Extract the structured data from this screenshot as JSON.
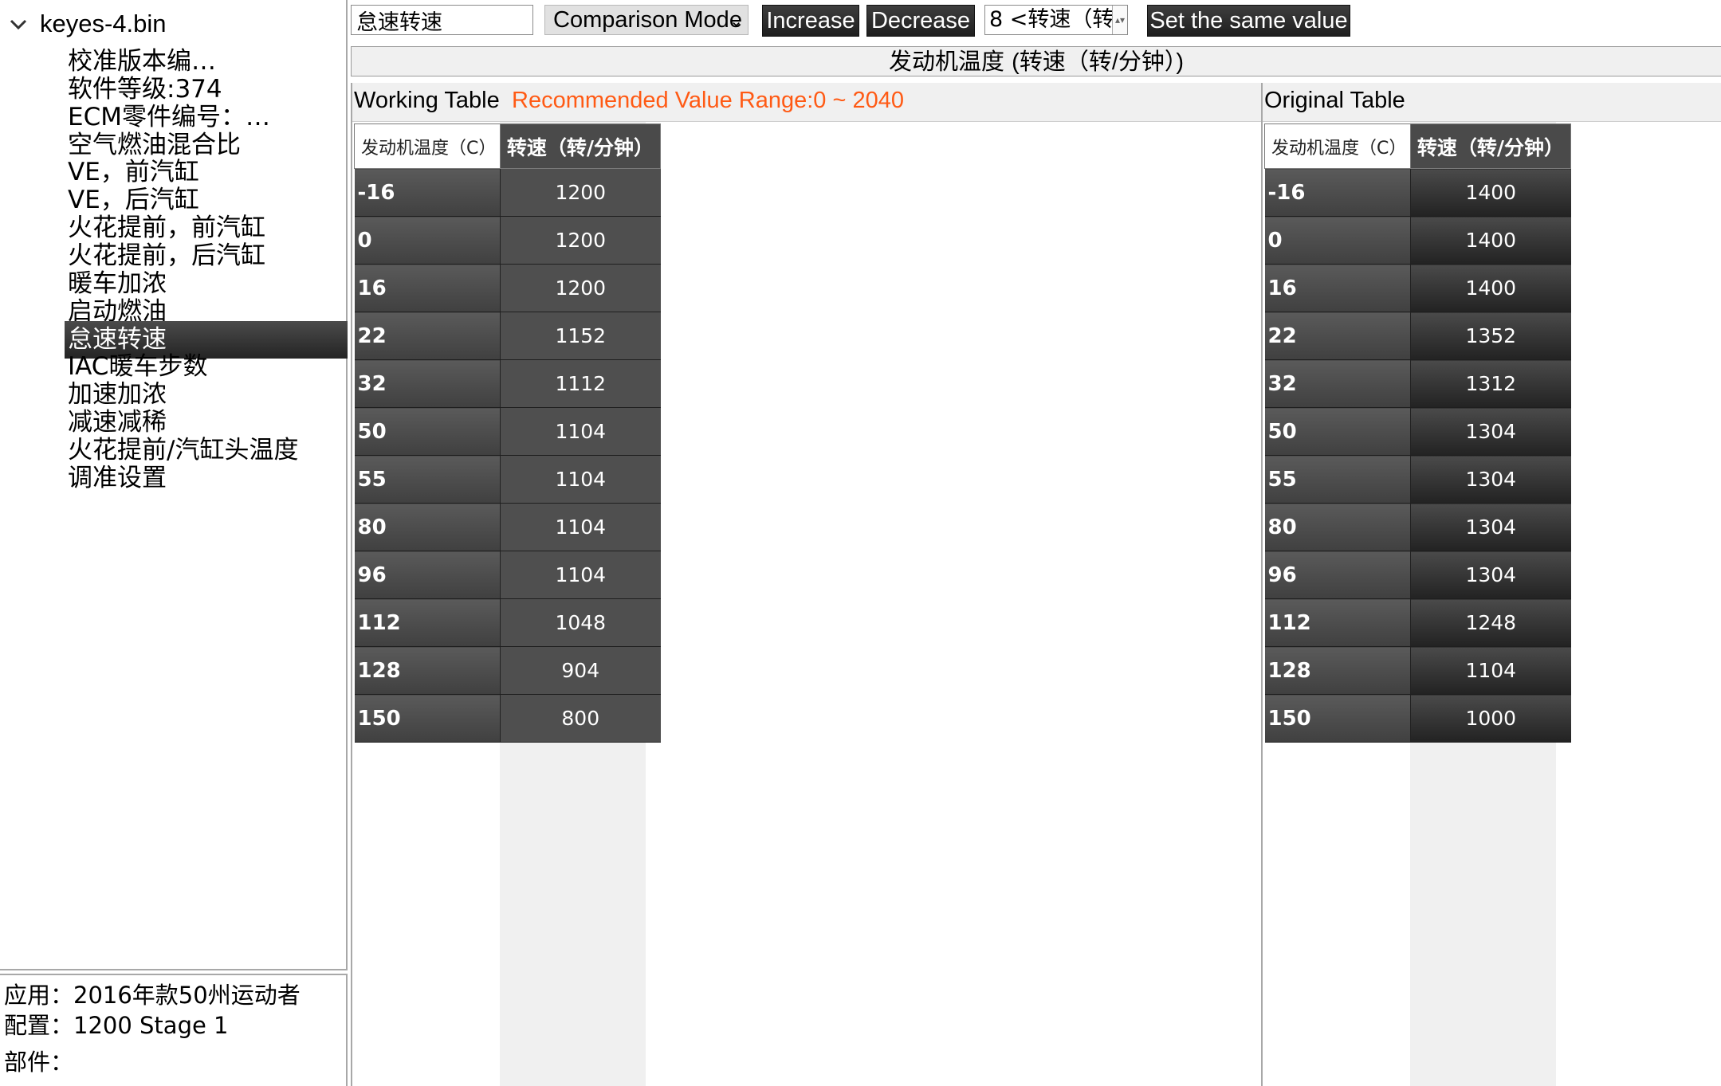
{
  "tree": {
    "root": "keyes-4.bin",
    "items": [
      "校准版本编…",
      "软件等级:374",
      "ECM零件编号：…",
      "空气燃油混合比",
      "VE，前汽缸",
      "VE，后汽缸",
      "火花提前，前汽缸",
      "火花提前，后汽缸",
      "暖车加浓",
      "启动燃油",
      "怠速转速",
      "IAC暖车步数",
      "加速加浓",
      "减速减稀",
      "火花提前/汽缸头温度",
      "调准设置"
    ],
    "selected_index": 10
  },
  "info": {
    "application": "应用：2016年款50州运动者",
    "config": "配置：1200 Stage 1",
    "parts": "部件："
  },
  "toolbar": {
    "search_value": "怠速转速",
    "mode": "Comparison Mode",
    "increase": "Increase",
    "decrease": "Decrease",
    "series_select": "8 <转速（转",
    "set_same": "Set the same value"
  },
  "header": {
    "title_a": "发动机温度 ",
    "title_b": "(转速（转/分钟）)"
  },
  "working": {
    "label": "Working Table",
    "range": "Recommended Value Range:0 ~ 2040",
    "col_key": "发动机温度（C）",
    "col_val": "转速（转/分钟）",
    "rows": [
      {
        "k": "-16",
        "v": "1200"
      },
      {
        "k": "0",
        "v": "1200"
      },
      {
        "k": "16",
        "v": "1200"
      },
      {
        "k": "22",
        "v": "1152"
      },
      {
        "k": "32",
        "v": "1112"
      },
      {
        "k": "50",
        "v": "1104"
      },
      {
        "k": "55",
        "v": "1104"
      },
      {
        "k": "80",
        "v": "1104"
      },
      {
        "k": "96",
        "v": "1104"
      },
      {
        "k": "112",
        "v": "1048"
      },
      {
        "k": "128",
        "v": "904"
      },
      {
        "k": "150",
        "v": "800"
      }
    ]
  },
  "original": {
    "label": "Original Table",
    "col_key": "发动机温度（C）",
    "col_val": "转速（转/分钟）",
    "rows": [
      {
        "k": "-16",
        "v": "1400"
      },
      {
        "k": "0",
        "v": "1400"
      },
      {
        "k": "16",
        "v": "1400"
      },
      {
        "k": "22",
        "v": "1352"
      },
      {
        "k": "32",
        "v": "1312"
      },
      {
        "k": "50",
        "v": "1304"
      },
      {
        "k": "55",
        "v": "1304"
      },
      {
        "k": "80",
        "v": "1304"
      },
      {
        "k": "96",
        "v": "1304"
      },
      {
        "k": "112",
        "v": "1248"
      },
      {
        "k": "128",
        "v": "1104"
      },
      {
        "k": "150",
        "v": "1000"
      }
    ]
  }
}
